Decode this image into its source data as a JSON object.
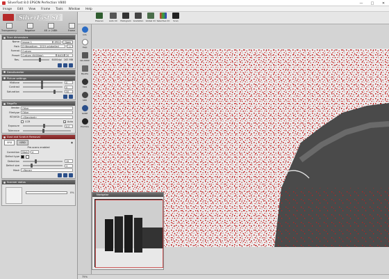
{
  "window": {
    "title": "SilverFast 8.0 EPSON Perfection V800"
  },
  "menu": [
    "Image",
    "Edit",
    "View",
    "Frame",
    "Tools",
    "Window",
    "Help"
  ],
  "brand": {
    "logo": "SilverFast SE",
    "modes": [
      "Transparency",
      "Negative",
      "48 -> 24Bit",
      "Frame"
    ]
  },
  "scan_dimensions": {
    "header": "Scan dimensions",
    "name_label": "Name",
    "name_value": "Image 1",
    "format_value": "JPEG 3",
    "open_label": "Open",
    "path_label": "Path",
    "path_value": "D:\\Negatives - 2019 unlabelled",
    "format_label": "Format",
    "format_select": "Custom",
    "preset_label": "Preset",
    "preset_select": "Custom (6400dpi)",
    "preset_dpi": "6400",
    "preset_num": "20",
    "res_label": "Res.",
    "res_value": "6400dpi",
    "res_size": "163 MB"
  },
  "densitometer": {
    "header": "Densitometer"
  },
  "picture_settings": {
    "header": "Picture settings",
    "midtone_label": "Midtone",
    "midtone_value": "0",
    "contrast_label": "Contrast",
    "contrast_value": "0",
    "saturation_label": "Saturation",
    "saturation_value": "50",
    "midtone_level": 0.5,
    "contrast_level": 0.5,
    "saturation_level": 0.85
  },
  "negafix": {
    "header": "NegaFix",
    "vendor_label": "Vendor",
    "vendor_value": "Other",
    "filmtype_label": "Filmtype",
    "filmtype_value": "Other",
    "iso_label": "ISO/ASA",
    "iso_value": "<Standard>",
    "ccr_label": "CCR",
    "auto_label": "Auto",
    "exposure_label": "Exposure",
    "exposure_value": "0.0",
    "tolerance_label": "Tolerance"
  },
  "dust": {
    "header": "Dust and Scratch Removal",
    "tabs": [
      "SRD",
      "iSRD"
    ],
    "status": "Pre-scans enabled",
    "correction_label": "Correction",
    "correction_value": "Mark",
    "correction_num": "4",
    "defect_type_label": "Defect type",
    "detection_label": "Detection",
    "detection_value": "15",
    "defect_size_label": "Defect size",
    "defect_size_value": "3",
    "mask_label": "Mask",
    "mask_value": "<None>"
  },
  "scanner_status": {
    "header": "Scanner status",
    "progress": 0,
    "progress_label": "0%"
  },
  "navigator": {
    "header": "Navigator"
  },
  "toolbar": [
    "Prescan",
    "Auto CC",
    "Histogram",
    "Gradation",
    "Global CC",
    "Selective CC",
    "Scan"
  ],
  "icon_column": [
    "Info",
    "Help",
    "NoUDPW",
    "Pipette",
    "HDR",
    "SRD",
    "GANE",
    "PreView"
  ],
  "status_bar": {
    "zoom": "75%"
  },
  "colors": {
    "accent_red": "#c62a2a",
    "panel_header": "#5a5a5a",
    "preview_bg": "#f0f0f0"
  }
}
